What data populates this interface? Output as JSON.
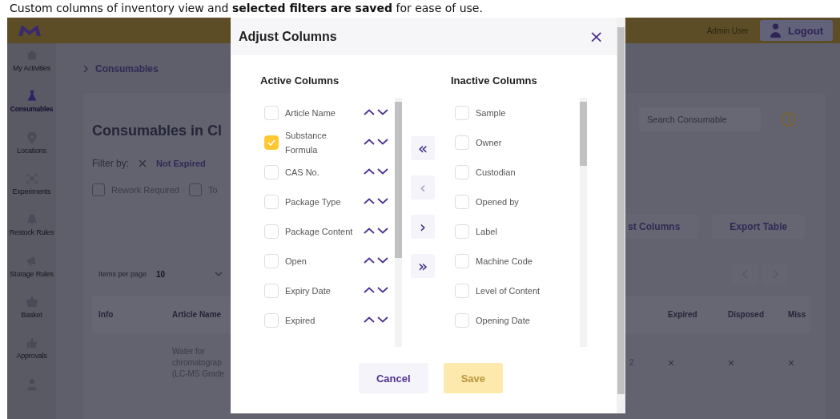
{
  "caption": "Custom columns of inventory view and **selected filters are saved** for ease of use.",
  "header": {
    "user": "Admin User",
    "logout": "Logout"
  },
  "sidebar": {
    "items": [
      {
        "label": "My Activities",
        "selected": false
      },
      {
        "label": "Consumables",
        "selected": true
      },
      {
        "label": "Locations",
        "selected": false
      },
      {
        "label": "Experiments",
        "selected": false
      },
      {
        "label": "Restock Rules",
        "selected": false
      },
      {
        "label": "Storage Rules",
        "selected": false
      },
      {
        "label": "Basket",
        "selected": false
      },
      {
        "label": "Approvals",
        "selected": false
      },
      {
        "selected": false
      }
    ]
  },
  "breadcrumb": "Consumables",
  "page": {
    "title": "Consumables in Cl",
    "filter_label": "Filter by:",
    "filters": [
      {
        "label": "Not Expired"
      }
    ],
    "checkboxes": [
      {
        "label": "Rework Required",
        "checked": false
      },
      {
        "label": "To",
        "checked": false
      }
    ],
    "search": {
      "placeholder": "Search Consumable"
    },
    "actions": [
      "st Columns",
      "Export Table"
    ],
    "items_per_page": {
      "label": "Items per page",
      "value": "10"
    },
    "table": {
      "columns": [
        "Info",
        "Article Name",
        "Expired",
        "Disposed",
        "Miss"
      ],
      "rows": [
        {
          "article_name": "Water for\nchromatograp\n(LC-MS Grade",
          "column_3": "2",
          "expired": "×",
          "disposed": "×",
          "miss": "×"
        }
      ]
    }
  },
  "dialog": {
    "title": "Adjust Columns",
    "close": "×",
    "active": {
      "heading": "Active Columns",
      "items": [
        {
          "label": "Article Name",
          "checked": false
        },
        {
          "label": "Substance Formula",
          "checked": true
        },
        {
          "label": "CAS No.",
          "checked": false
        },
        {
          "label": "Package Type",
          "checked": false
        },
        {
          "label": "Package Content",
          "checked": false
        },
        {
          "label": "Open",
          "checked": false
        },
        {
          "label": "Expiry Date",
          "checked": false
        },
        {
          "label": "Expired",
          "checked": false
        }
      ]
    },
    "transfer": [
      {
        "label": "«",
        "disabled": false
      },
      {
        "label": "‹",
        "disabled": true
      },
      {
        "label": "›",
        "disabled": false
      },
      {
        "label": "»",
        "disabled": false
      }
    ],
    "inactive": {
      "heading": "Inactive Columns",
      "items": [
        {
          "label": "Sample",
          "checked": false
        },
        {
          "label": "Owner",
          "checked": false
        },
        {
          "label": "Custodian",
          "checked": false
        },
        {
          "label": "Opened by",
          "checked": false
        },
        {
          "label": "Label",
          "checked": false
        },
        {
          "label": "Machine Code",
          "checked": false
        },
        {
          "label": "Level of Content",
          "checked": false
        },
        {
          "label": "Opening Date",
          "checked": false
        }
      ]
    },
    "buttons": [
      {
        "label": "Cancel",
        "kind": "secondary",
        "disabled": false
      },
      {
        "label": "Save",
        "kind": "primary",
        "disabled": true
      }
    ]
  }
}
